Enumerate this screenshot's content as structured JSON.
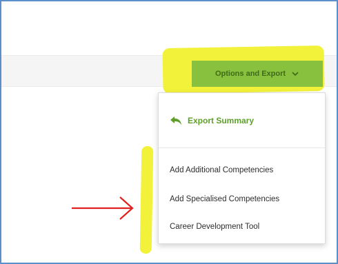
{
  "options_button": {
    "label": "Options and Export"
  },
  "dropdown": {
    "export_label": "Export Summary",
    "items": [
      {
        "label": "Add Additional Competencies"
      },
      {
        "label": "Add Specialised Competencies"
      },
      {
        "label": "Career Development Tool"
      }
    ]
  },
  "colors": {
    "button_bg": "#88c13e",
    "highlight": "#f2f23a",
    "accent_green": "#5e9e2a",
    "arrow_red": "#e02020",
    "frame_blue": "#5a8fc9"
  },
  "icons": {
    "export": "reply-arrow-icon",
    "dropdown": "chevron-down-icon",
    "annotation": "right-arrow-icon"
  }
}
